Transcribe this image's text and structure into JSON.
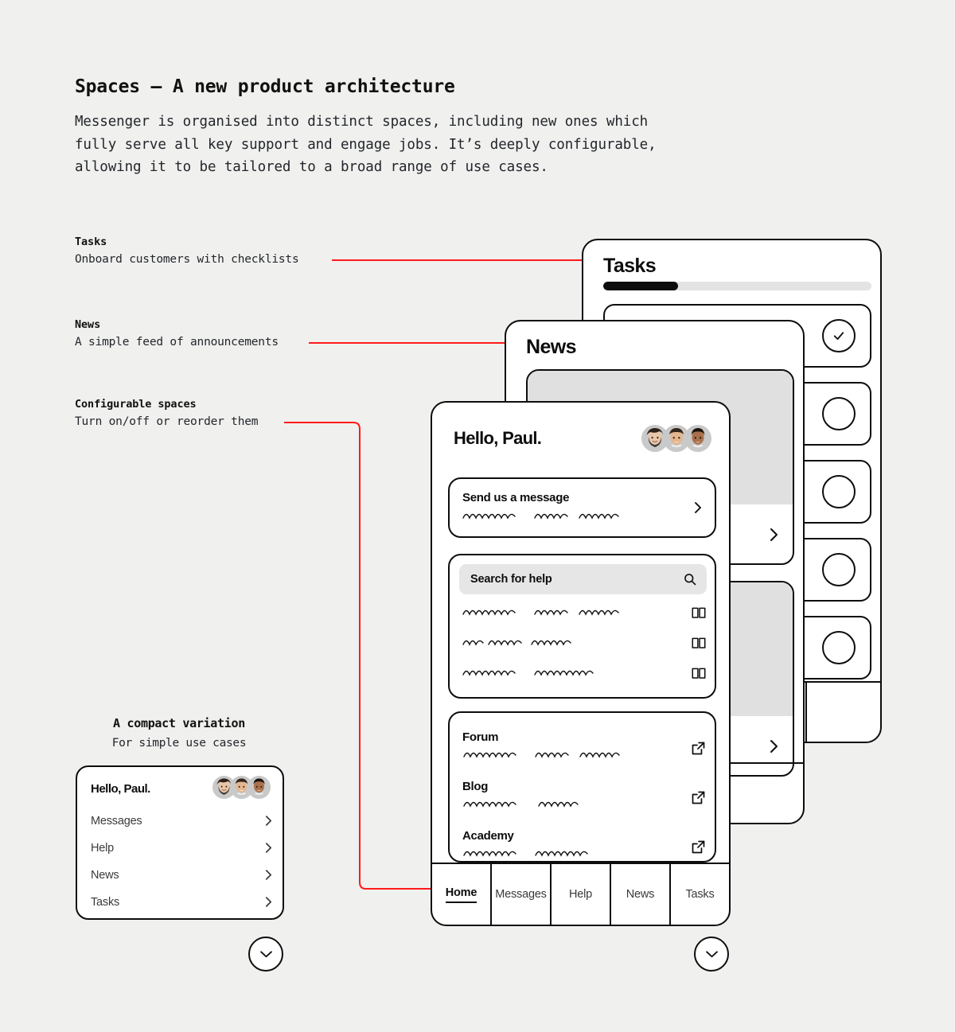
{
  "page": {
    "headline": "Spaces — A new product architecture",
    "body_lines": [
      "Messenger is organised into distinct spaces, including new ones which",
      "fully serve all key support and engage jobs. It’s deeply configurable,",
      "allowing it to be tailored to a broad range of use cases."
    ],
    "background_color": "#f0f0ef",
    "accent_color": "#ff1a1a",
    "ink_color": "#0d0d0d"
  },
  "annotations": [
    {
      "title": "Tasks",
      "desc": "Onboard customers with checklists"
    },
    {
      "title": "News",
      "desc": "A simple feed of announcements"
    },
    {
      "title": "Configurable spaces",
      "desc": "Turn on/off or reorder them"
    }
  ],
  "tasks_card": {
    "title": "Tasks",
    "progress_percent": 28,
    "tasks": [
      {
        "checked": true
      },
      {
        "checked": false
      },
      {
        "checked": false
      },
      {
        "checked": false
      },
      {
        "checked": false
      }
    ],
    "check_icon": "check-icon"
  },
  "news_card": {
    "title": "News",
    "items": [
      {
        "chevron": "chevron-right-icon"
      },
      {
        "chevron": "chevron-right-icon"
      }
    ]
  },
  "home_card": {
    "greeting": "Hello, Paul.",
    "avatars": [
      "avatar-1",
      "avatar-2",
      "avatar-3"
    ],
    "send_message": {
      "title": "Send us a message",
      "chevron": "chevron-right-icon"
    },
    "help": {
      "search_placeholder": "Search for help",
      "search_icon": "search-icon",
      "articles": [
        {
          "icon": "book-icon"
        },
        {
          "icon": "book-icon"
        },
        {
          "icon": "book-icon"
        }
      ]
    },
    "links": [
      {
        "title": "Forum",
        "icon": "external-link-icon"
      },
      {
        "title": "Blog",
        "icon": "external-link-icon"
      },
      {
        "title": "Academy",
        "icon": "external-link-icon"
      }
    ],
    "tabs": [
      {
        "label": "Home",
        "active": true
      },
      {
        "label": "Messages",
        "active": false
      },
      {
        "label": "Help",
        "active": false
      },
      {
        "label": "News",
        "active": false
      },
      {
        "label": "Tasks",
        "active": false
      }
    ]
  },
  "compact": {
    "title": "A compact variation",
    "subtitle": "For simple use cases",
    "greeting": "Hello, Paul.",
    "avatars": [
      "avatar-1",
      "avatar-2",
      "avatar-3"
    ],
    "rows": [
      {
        "label": "Messages",
        "chevron": "chevron-right-icon"
      },
      {
        "label": "Help",
        "chevron": "chevron-right-icon"
      },
      {
        "label": "News",
        "chevron": "chevron-right-icon"
      },
      {
        "label": "Tasks",
        "chevron": "chevron-right-icon"
      }
    ]
  },
  "launchers": [
    {
      "icon": "chevron-down-icon"
    },
    {
      "icon": "chevron-down-icon"
    }
  ]
}
